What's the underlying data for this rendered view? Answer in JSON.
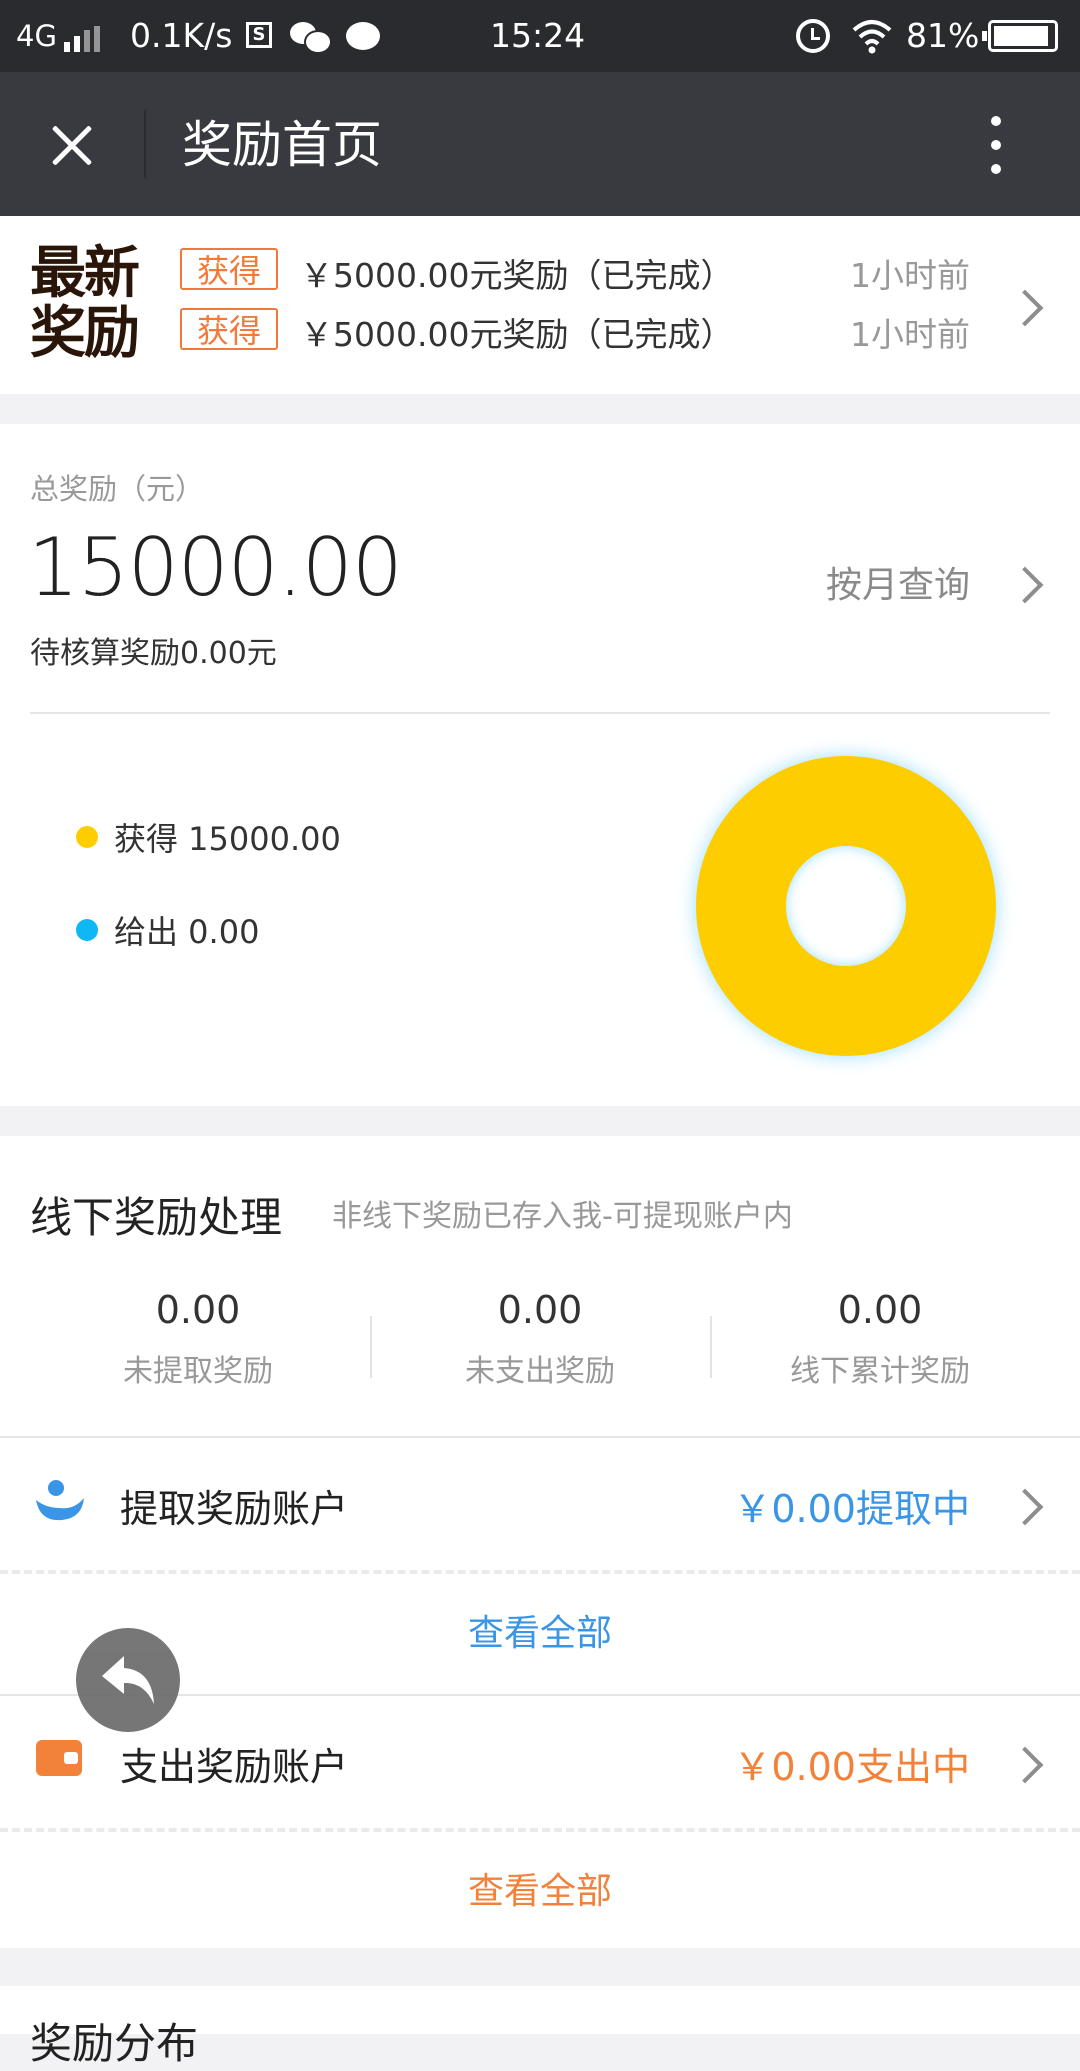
{
  "status_bar": {
    "network": "4G",
    "speed": "0.1K/s",
    "time": "15:24",
    "battery": "81%"
  },
  "nav": {
    "title": "奖励首页"
  },
  "news": {
    "logo_line1": "最新",
    "logo_line2": "奖励",
    "items": [
      {
        "tag": "获得",
        "text": "￥5000.00元奖励（已完成）",
        "time": "1小时前"
      },
      {
        "tag": "获得",
        "text": "￥5000.00元奖励（已完成）",
        "time": "1小时前"
      }
    ]
  },
  "summary": {
    "label": "总奖励（元）",
    "total": "15000.00",
    "month_query": "按月查询",
    "pending": "待核算奖励0.00元"
  },
  "chart_data": {
    "type": "pie",
    "categories": [
      "获得",
      "给出"
    ],
    "values": [
      15000.0,
      0.0
    ],
    "labels": [
      "获得 15000.00",
      "给出 0.00"
    ],
    "colors": [
      "#fecd00",
      "#10b7f5"
    ]
  },
  "offline": {
    "title": "线下奖励处理",
    "subtitle": "非线下奖励已存入我-可提现账户内",
    "stats": [
      {
        "value": "0.00",
        "label": "未提取奖励"
      },
      {
        "value": "0.00",
        "label": "未支出奖励"
      },
      {
        "value": "0.00",
        "label": "线下累计奖励"
      }
    ]
  },
  "accounts": {
    "withdraw": {
      "label": "提取奖励账户",
      "value": "￥0.00提取中",
      "view_all": "查看全部",
      "color": "#3a95e6"
    },
    "expense": {
      "label": "支出奖励账户",
      "value": "￥0.00支出中",
      "view_all": "查看全部",
      "color": "#f2813a"
    }
  },
  "distribution": {
    "title": "奖励分布"
  }
}
